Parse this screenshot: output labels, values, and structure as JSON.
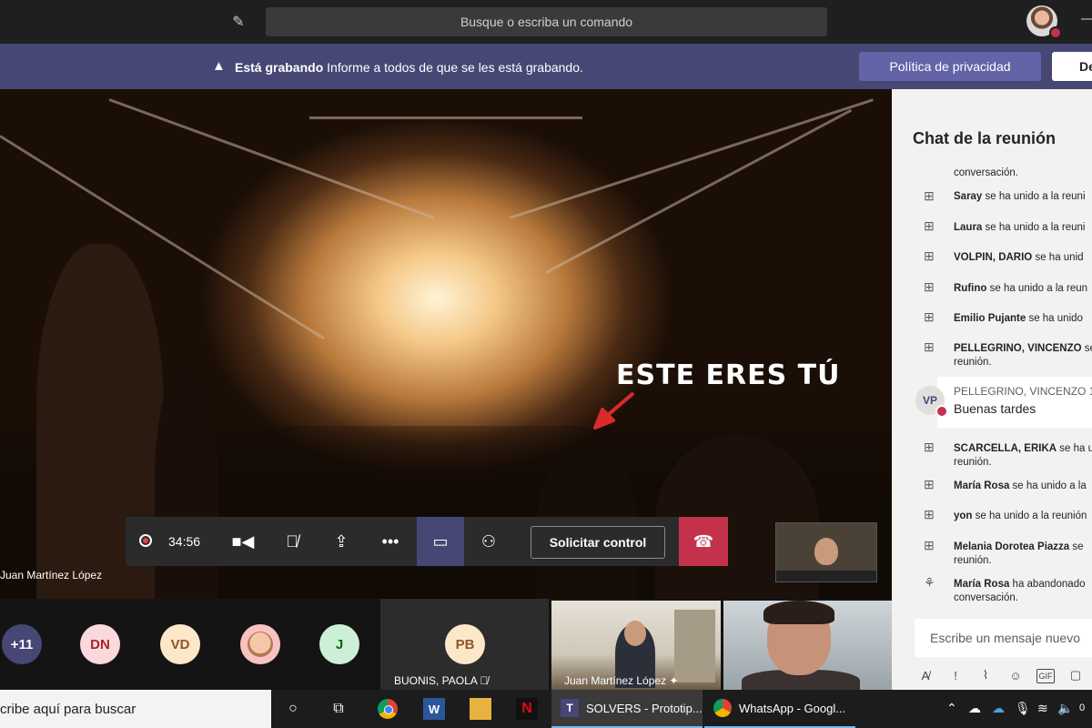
{
  "topbar": {
    "search_placeholder": "Busque o escriba un comando"
  },
  "banner": {
    "title": "Está grabando",
    "message": "Informe a todos de que se les está grabando.",
    "privacy_label": "Política de privacidad",
    "dismiss_label": "De"
  },
  "stage": {
    "overlay_text": "ESTE ERES TÚ",
    "presenter_name": "Juan Martínez López"
  },
  "controls": {
    "timer": "34:56",
    "request_control_label": "Solicitar control"
  },
  "participants": {
    "avatars": [
      {
        "initials": "+11",
        "bg": "#464775",
        "fg": "#ffffff"
      },
      {
        "initials": "DN",
        "bg": "#fbd8dc",
        "fg": "#a4262c"
      },
      {
        "initials": "VD",
        "bg": "#fde7c9",
        "fg": "#8e562e"
      },
      {
        "initials": "",
        "bg": "#f7c2c0",
        "fg": "#000000"
      },
      {
        "initials": "J",
        "bg": "#cdefd8",
        "fg": "#0b6a0b"
      }
    ],
    "pb_initials": "PB",
    "pb_name": "BUONIS, PAOLA",
    "video1_name": "Juan Martínez López"
  },
  "chat": {
    "title": "Chat de la reunión",
    "messages": [
      {
        "name": "",
        "text": "conversación."
      },
      {
        "name": "Saray",
        "text": " se ha unido a la reuni"
      },
      {
        "name": "Laura",
        "text": " se ha unido a la reuni"
      },
      {
        "name": "VOLPIN, DARIO",
        "text": " se ha unid"
      },
      {
        "name": "Rufino",
        "text": " se ha unido a la reun"
      },
      {
        "name": "Emilio Pujante",
        "text": " se ha unido"
      },
      {
        "name": "PELLEGRINO, VINCENZO",
        "text": " se"
      },
      {
        "name": "",
        "text": "reunión."
      },
      {
        "name": "SCARCELLA, ERIKA",
        "text": " se ha un"
      },
      {
        "name": "",
        "text": "reunión."
      },
      {
        "name": "María Rosa",
        "text": " se ha unido a la"
      },
      {
        "name": "yon",
        "text": " se ha unido a la reunión"
      },
      {
        "name": "Melania Dorotea Piazza",
        "text": " se"
      },
      {
        "name": "",
        "text": "reunión."
      },
      {
        "name": "María Rosa",
        "text": " ha abandonado"
      },
      {
        "name": "",
        "text": "conversación."
      }
    ],
    "vp_initials": "VP",
    "vp_name": "PELLEGRINO, VINCENZO   1",
    "vp_text": "Buenas tardes",
    "input_placeholder": "Escribe un mensaje nuevo"
  },
  "taskbar": {
    "search_text": "cribe aquí para buscar",
    "app_teams": "SOLVERS - Prototip...",
    "app_whatsapp": "WhatsApp - Googl...",
    "clock": "0"
  }
}
